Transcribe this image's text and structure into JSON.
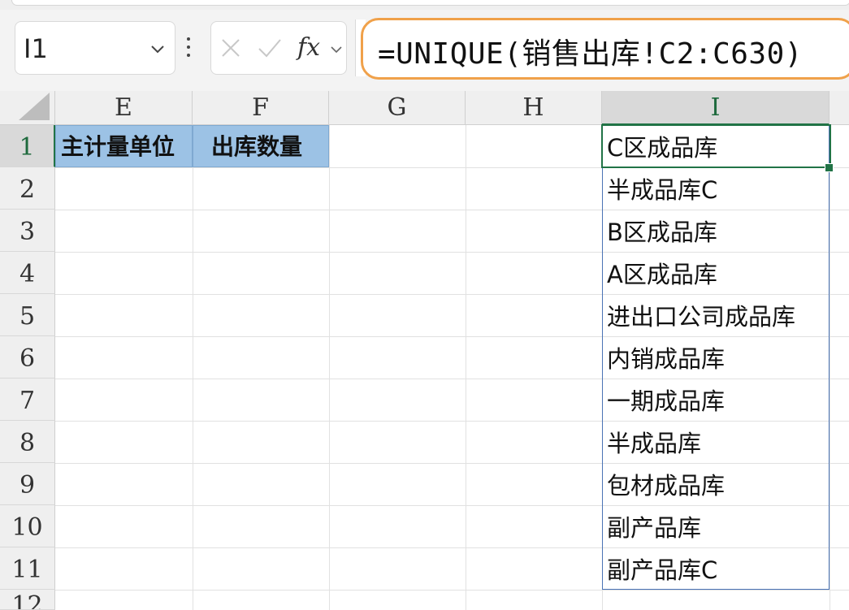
{
  "formula_bar": {
    "name_box": "I1",
    "fx_label": "fx",
    "formula": "=UNIQUE(销售出库!C2:C630)"
  },
  "columns": [
    {
      "id": "E",
      "label": "E"
    },
    {
      "id": "F",
      "label": "F"
    },
    {
      "id": "G",
      "label": "G"
    },
    {
      "id": "H",
      "label": "H"
    },
    {
      "id": "I",
      "label": "I"
    }
  ],
  "rows": [
    "1",
    "2",
    "3",
    "4",
    "5",
    "6",
    "7",
    "8",
    "9",
    "10",
    "11",
    "12"
  ],
  "header_cells": {
    "E1": "主计量单位",
    "F1": "出库数量"
  },
  "spill_values": [
    "C区成品库",
    "半成品库C",
    "B区成品库",
    "A区成品库",
    "进出口公司成品库",
    "内销成品库",
    "一期成品库",
    "半成品库",
    "包材成品库",
    "副产品库",
    "副产品库C"
  ],
  "colors": {
    "accent_orange": "#f0a14a",
    "header_fill": "#9cc2e5",
    "selection_green": "#217346",
    "spill_border": "#4a73b5"
  }
}
